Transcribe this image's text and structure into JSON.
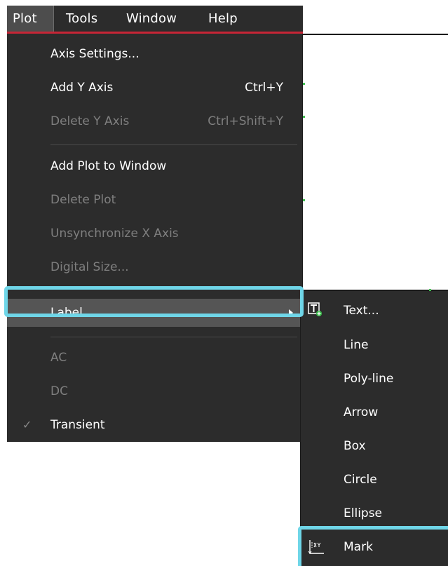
{
  "menubar": {
    "items": [
      {
        "label": "Plot"
      },
      {
        "label": "Tools"
      },
      {
        "label": "Window"
      },
      {
        "label": "Help"
      }
    ]
  },
  "plot_menu": {
    "items": [
      {
        "label": "Axis Settings...",
        "shortcut": ""
      },
      {
        "label": "Add Y Axis",
        "shortcut": "Ctrl+Y"
      },
      {
        "label": "Delete Y Axis",
        "shortcut": "Ctrl+Shift+Y"
      },
      {
        "label": "Add Plot to Window",
        "shortcut": ""
      },
      {
        "label": "Delete Plot",
        "shortcut": ""
      },
      {
        "label": "Unsynchronize X Axis",
        "shortcut": ""
      },
      {
        "label": "Digital Size...",
        "shortcut": ""
      },
      {
        "label": "Label",
        "shortcut": ""
      },
      {
        "label": "AC",
        "shortcut": ""
      },
      {
        "label": "DC",
        "shortcut": ""
      },
      {
        "label": "Transient",
        "shortcut": ""
      }
    ],
    "check_glyph": "✓"
  },
  "label_submenu": {
    "items": [
      {
        "label": "Text...",
        "icon": "text-label-icon"
      },
      {
        "label": "Line"
      },
      {
        "label": "Poly-line"
      },
      {
        "label": "Arrow"
      },
      {
        "label": "Box"
      },
      {
        "label": "Circle"
      },
      {
        "label": "Ellipse"
      },
      {
        "label": "Mark",
        "icon": "mark-icon"
      }
    ]
  },
  "colors": {
    "menu_bg": "#2c2c2c",
    "highlight_bg": "#555555",
    "disabled_text": "#7f7f7f",
    "accent_red": "#c72536",
    "focus_cyan": "#6fd6e8"
  }
}
